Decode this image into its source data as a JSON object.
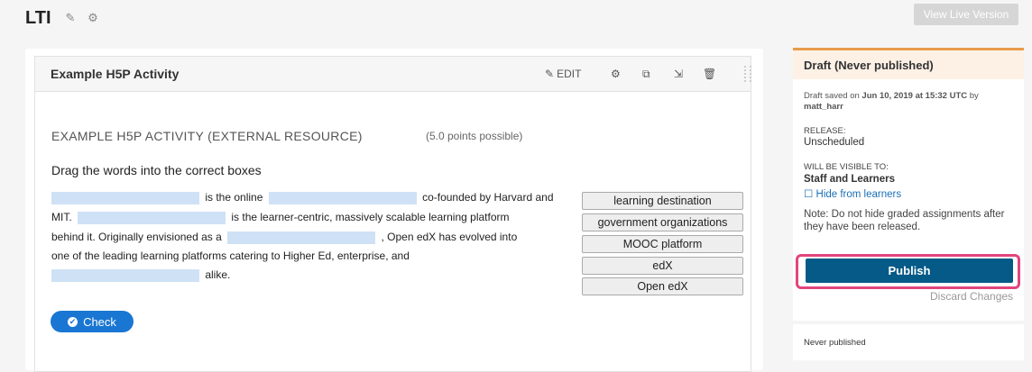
{
  "header": {
    "title": "LTI",
    "edit_icon": "pencil-icon",
    "settings_icon": "gear-icon",
    "view_live_label": "View Live Version"
  },
  "unit": {
    "title": "Example H5P Activity",
    "actions": {
      "edit_label": "EDIT",
      "settings_icon": "gear-icon",
      "duplicate_icon": "duplicate-icon",
      "move_icon": "move-icon",
      "delete_icon": "trash-icon",
      "drag_icon": "drag-handle-icon"
    },
    "external_title": "EXAMPLE H5P ACTIVITY (EXTERNAL RESOURCE)",
    "points": "(5.0 points possible)",
    "prompt": "Drag the words into the correct boxes",
    "sentence": {
      "l1_t1": "is the online",
      "l1_t2": "co-founded by Harvard and",
      "l2_t1": "MIT.",
      "l2_t2": "is the learner-centric, massively scalable learning platform",
      "l3_t1": "behind it. Originally envisioned as a",
      "l3_t2": ", Open edX has evolved into",
      "l4_t1": "one of the leading learning platforms catering to Higher Ed, enterprise, and",
      "l5_t1": "alike."
    },
    "words": [
      "learning destination",
      "government organizations",
      "MOOC platform",
      "edX",
      "Open edX"
    ],
    "check_label": "Check"
  },
  "sidebar": {
    "status_title": "Draft (Never published)",
    "draft_saved_prefix": "Draft saved on ",
    "draft_saved_date": "Jun 10, 2019 at 15:32 UTC",
    "draft_saved_by": " by",
    "draft_saved_user": "matt_harr",
    "release_label": "RELEASE:",
    "release_value": "Unscheduled",
    "visible_label": "WILL BE VISIBLE TO:",
    "visible_value": "Staff and Learners",
    "hide_label": "Hide from learners",
    "note": "Note: Do not hide graded assignments after they have been released.",
    "publish_label": "Publish",
    "discard_label": "Discard Changes",
    "never_published": "Never published"
  }
}
